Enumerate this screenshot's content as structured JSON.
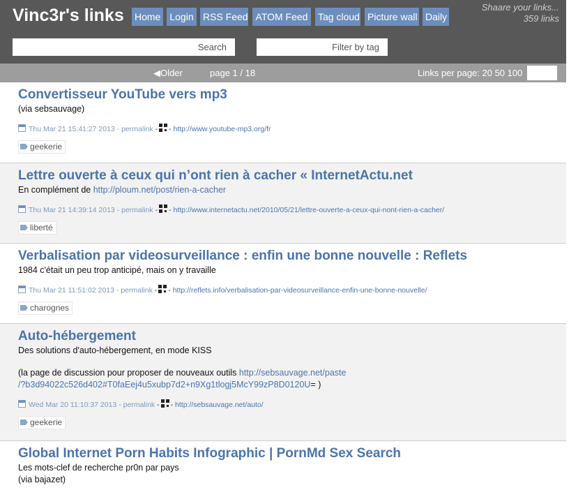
{
  "header": {
    "title": "Vinc3r's links",
    "nav": [
      "Home",
      "Login",
      "RSS Feed",
      "ATOM Feed",
      "Tag cloud",
      "Picture wall",
      "Daily"
    ],
    "tagline": "Shaare your links...",
    "link_count": "359 links",
    "search_label": "Search",
    "filter_label": "Filter by tag"
  },
  "paging": {
    "older": "◀Older",
    "page": "page 1 / 18",
    "links_per_page": "Links per page: 20 50 100"
  },
  "links": [
    {
      "title": "Convertisseur YouTube vers mp3",
      "desc": "(via sebsauvage)",
      "date": "Thu Mar 21 15:41:27 2013",
      "permalink": "permalink",
      "url": "http://www.youtube-mp3.org/fr",
      "tag": "geekerie"
    },
    {
      "title": "Lettre ouverte à ceux qui n’ont rien à cacher « InternetActu.net",
      "desc_prefix": "En complément de ",
      "desc_link": "http://ploum.net/post/rien-a-cacher",
      "date": "Thu Mar 21 14:39:14 2013",
      "permalink": "permalink",
      "url": "http://www.internetactu.net/2010/05/21/lettre-ouverte-a-ceux-qui-nont-rien-a-cacher/",
      "tag": "liberté"
    },
    {
      "title": "Verbalisation par videosurveillance : enfin une bonne nouvelle : Reflets",
      "desc": "1984 c'était un peu trop anticipé, mais on y travaille",
      "date": "Thu Mar 21 11:51:02 2013",
      "permalink": "permalink",
      "url": "http://reflets.info/verbalisation-par-videosurveillance-enfin-une-bonne-nouvelle/",
      "tag": "charognes"
    },
    {
      "title": "Auto-hébergement",
      "desc": "Des solutions d'auto-hébergement, en mode KISS",
      "desc2_prefix": "(la page de discussion pour proposer de nouveaux outils ",
      "desc2_link_a": "http://sebsauvage.net/paste",
      "desc2_link_b": "/?b3d94022c526d402#T0faEej4u5xubp7d2+n9Xg1tlogj5McY99zP8D0120U",
      "desc2_suffix": "= )",
      "date": "Wed Mar 20 11:10:37 2013",
      "permalink": "permalink",
      "url": "http://sebsauvage.net/auto/",
      "tag": "geekerie"
    },
    {
      "title": "Global Internet Porn Habits Infographic | PornMd Sex Search",
      "desc": "Les mots-clef de recherche pr0n par pays",
      "desc2": "(via bajazet)"
    }
  ]
}
